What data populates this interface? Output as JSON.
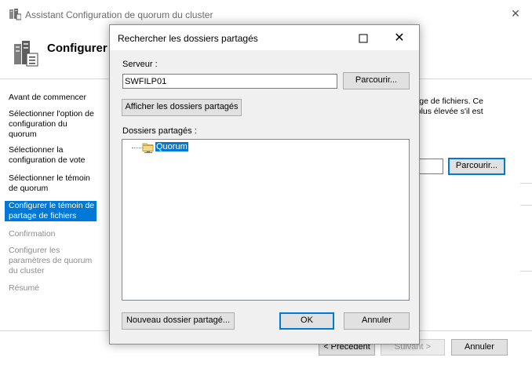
{
  "wizard": {
    "title": "Assistant Configuration de quorum du cluster",
    "heading": "Configurer",
    "nav": [
      {
        "label": "Avant de commencer",
        "state": "normal"
      },
      {
        "label": "Sélectionner l'option de configuration du quorum",
        "state": "normal"
      },
      {
        "label": "Sélectionner la configuration de vote",
        "state": "normal"
      },
      {
        "label": "Sélectionner le témoin de quorum",
        "state": "normal"
      },
      {
        "label": "Configurer le témoin de partage de fichiers",
        "state": "active"
      },
      {
        "label": "Confirmation",
        "state": "disabled"
      },
      {
        "label": "Configurer les paramètres de quorum du cluster",
        "state": "disabled"
      },
      {
        "label": "Résumé",
        "state": "disabled"
      }
    ],
    "description_line1": "rtage de fichiers. Ce",
    "description_line2": "e plus élevée s'il est",
    "browse_label": "Parcourir...",
    "prev_label": "< Précédent",
    "next_label": "Suivant >",
    "cancel_label": "Annuler"
  },
  "dialog": {
    "title": "Rechercher les dossiers partagés",
    "server_label": "Serveur :",
    "server_value": "SWFILP01",
    "browse_label": "Parcourir...",
    "show_shares_label": "Afficher les dossiers partagés",
    "shares_label": "Dossiers partagés :",
    "tree_items": [
      {
        "label": "Quorum"
      }
    ],
    "new_folder_label": "Nouveau dossier partagé...",
    "ok_label": "OK",
    "cancel_label": "Annuler"
  },
  "colors": {
    "accent": "#0078d7",
    "dialog_bg": "#f0f0f0",
    "button_bg": "#e1e1e1",
    "disabled_text": "#8d8d8d"
  },
  "icons": {
    "wizard_title": "cluster-icon",
    "wizard_header": "cluster-config-icon",
    "tree_item": "shared-folder-icon"
  }
}
